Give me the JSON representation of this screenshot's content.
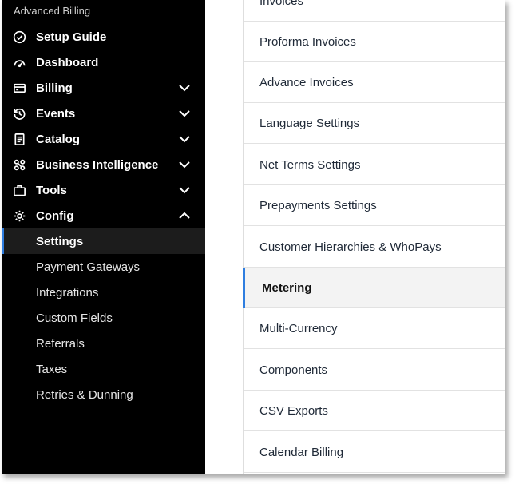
{
  "sidebar": {
    "brand": "Advanced Billing",
    "items": [
      {
        "label": "Setup Guide"
      },
      {
        "label": "Dashboard"
      },
      {
        "label": "Billing"
      },
      {
        "label": "Events"
      },
      {
        "label": "Catalog"
      },
      {
        "label": "Business Intelligence"
      },
      {
        "label": "Tools"
      },
      {
        "label": "Config"
      }
    ],
    "config_items": [
      {
        "label": "Settings"
      },
      {
        "label": "Payment Gateways"
      },
      {
        "label": "Integrations"
      },
      {
        "label": "Custom Fields"
      },
      {
        "label": "Referrals"
      },
      {
        "label": "Taxes"
      },
      {
        "label": "Retries & Dunning"
      }
    ]
  },
  "settings_menu": {
    "items": [
      {
        "label": "Invoices"
      },
      {
        "label": "Proforma Invoices"
      },
      {
        "label": "Advance Invoices"
      },
      {
        "label": "Language Settings"
      },
      {
        "label": "Net Terms Settings"
      },
      {
        "label": "Prepayments Settings"
      },
      {
        "label": "Customer Hierarchies & WhoPays"
      },
      {
        "label": "Metering"
      },
      {
        "label": "Multi-Currency"
      },
      {
        "label": "Components"
      },
      {
        "label": "CSV Exports"
      },
      {
        "label": "Calendar Billing"
      }
    ]
  },
  "colors": {
    "sidebar_bg": "#000000",
    "accent": "#2f7ee0",
    "active_row_bg": "#f3f3f3"
  },
  "icons": {
    "setup_guide": "check-circle-icon",
    "dashboard": "gauge-icon",
    "billing": "credit-card-icon",
    "events": "history-icon",
    "catalog": "document-icon",
    "business_intelligence": "nodes-icon",
    "tools": "briefcase-icon",
    "config": "gear-icon"
  }
}
